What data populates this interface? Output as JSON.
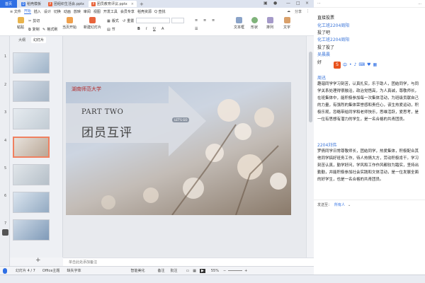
{
  "tabs": {
    "home": "首页",
    "items": [
      {
        "label": "稻壳模板",
        "icon": "D"
      },
      {
        "label": "团组织生活会.pptx",
        "icon": "P"
      },
      {
        "label": "团员教育评议.pptx",
        "icon": "P",
        "active": true
      }
    ]
  },
  "menu": {
    "file": "≡ 文件",
    "items": [
      "开始",
      "插入",
      "设计",
      "切换",
      "动画",
      "放映",
      "审阅",
      "视图",
      "开发工具",
      "会员专享",
      "稻壳资源"
    ],
    "search": "Q 查找",
    "share": "分享"
  },
  "ribbon": {
    "paste": "粘贴",
    "cut": "剪切",
    "copy": "复制",
    "format_painter": "格式刷",
    "from_current": "当页开始",
    "new_slide": "新建幻灯片",
    "layout": "版式",
    "section": "节",
    "reset": "重置",
    "font_name": "",
    "font_size": "",
    "bold": "B",
    "textbox": "文本框",
    "shape": "形状",
    "arrange": "排列",
    "wordart": "文字"
  },
  "thumbs_panel": {
    "tab_outline": "大纲",
    "tab_slides": "幻灯片",
    "slides": [
      1,
      2,
      3,
      4,
      5,
      6,
      7
    ],
    "selected": 4,
    "add": "+"
  },
  "slide": {
    "logo_text": "湖南师范大学",
    "part": "PART TWO",
    "title": "团员互评",
    "arrow_tag": "LET'S GO"
  },
  "notes": {
    "placeholder": "单击此处添加备注"
  },
  "status": {
    "slide_info": "幻灯片 4 / 7",
    "theme": "Office主题",
    "missing_font": "缺失字体",
    "smart": "智能美化",
    "notes_btn": "备注",
    "comment": "批注",
    "zoom": "55%"
  },
  "chat": {
    "header_right": "...",
    "messages": [
      {
        "type": "text",
        "text": "直接投票"
      },
      {
        "type": "name",
        "text": "化工班2204周阳"
      },
      {
        "type": "text",
        "text": "投了吧"
      },
      {
        "type": "name",
        "text": "化工班2204周阳"
      },
      {
        "type": "text",
        "text": "投了投了"
      },
      {
        "type": "name",
        "text": "吴晨晨"
      },
      {
        "type": "text",
        "text": "好"
      }
    ],
    "ime": "中",
    "sender1": "周迅",
    "para1": "趣谐同学学习刻苦，认真扎实，乐于助人，团结同学，与同学关系处理得很融洽，政治觉悟高，为人真诚，尊敬师长，在班集体中，能积极参加每一次集体活动，为班级贡献自己的力量，有强烈的集体荣誉感和责任心，该生热爱运动，积极乐观，忽略带给同学和老师快乐，思维活跃，爱思考，是一位有思想有潜力的学生，是一名合格的共青团员。",
    "sender2": "2204刘伟",
    "para2": "罗倩同学日常尊敬师长，团结同学，热爱集体，积极配合其他同学搞好班务工作，待人热情大方，劳动积极肯干。学习刻苦认真，勤学好问，学风和工作作风都较为踏实，坚持出勤勤，并能积极参加社会实践和文体活动，是一位发展全面的好学生，也是一名合格的共青团员。",
    "footer_label": "发送至：",
    "footer_target": "所有人"
  },
  "colors": {
    "accent": "#2f6fe4",
    "link": "#3a74d8",
    "wps_orange": "#e8643c"
  }
}
